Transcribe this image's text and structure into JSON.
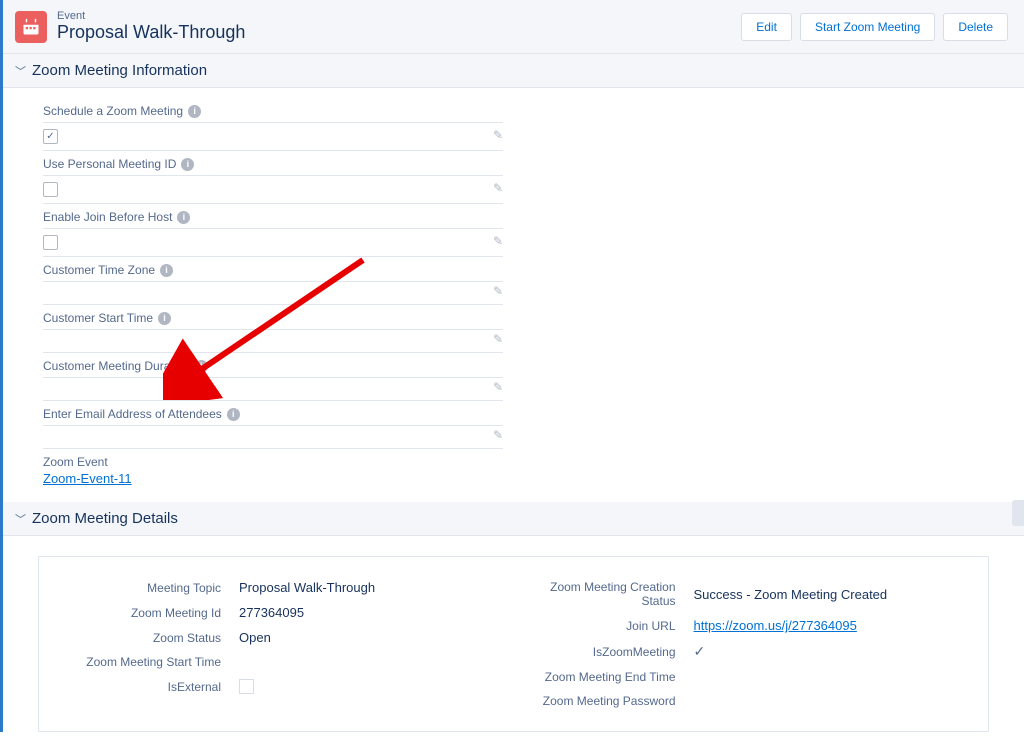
{
  "header": {
    "eyebrow": "Event",
    "title": "Proposal Walk-Through",
    "actions": {
      "edit": "Edit",
      "start": "Start Zoom Meeting",
      "delete": "Delete"
    }
  },
  "section_info_title": "Zoom Meeting Information",
  "fields": {
    "schedule": "Schedule a Zoom Meeting",
    "personal_id": "Use Personal Meeting ID",
    "join_before": "Enable Join Before Host",
    "cust_tz": "Customer Time Zone",
    "cust_start": "Customer Start Time",
    "cust_duration": "Customer Meeting Duration",
    "attendees": "Enter Email Address of Attendees",
    "zoom_event": "Zoom Event",
    "zoom_event_value": "Zoom-Event-11"
  },
  "section_details_title": "Zoom Meeting Details",
  "details": {
    "topic_label": "Meeting Topic",
    "topic_value": "Proposal Walk-Through",
    "id_label": "Zoom Meeting Id",
    "id_value": "277364095",
    "status_label": "Zoom Status",
    "status_value": "Open",
    "start_time_label": "Zoom Meeting Start Time",
    "start_time_value": "",
    "isexternal_label": "IsExternal",
    "creation_status_label": "Zoom Meeting Creation Status",
    "creation_status_value": "Success - Zoom Meeting Created",
    "join_url_label": "Join URL",
    "join_url_value": "https://zoom.us/j/277364095",
    "iszoom_label": "IsZoomMeeting",
    "end_time_label": "Zoom Meeting End Time",
    "end_time_value": "",
    "password_label": "Zoom Meeting Password",
    "password_value": ""
  }
}
